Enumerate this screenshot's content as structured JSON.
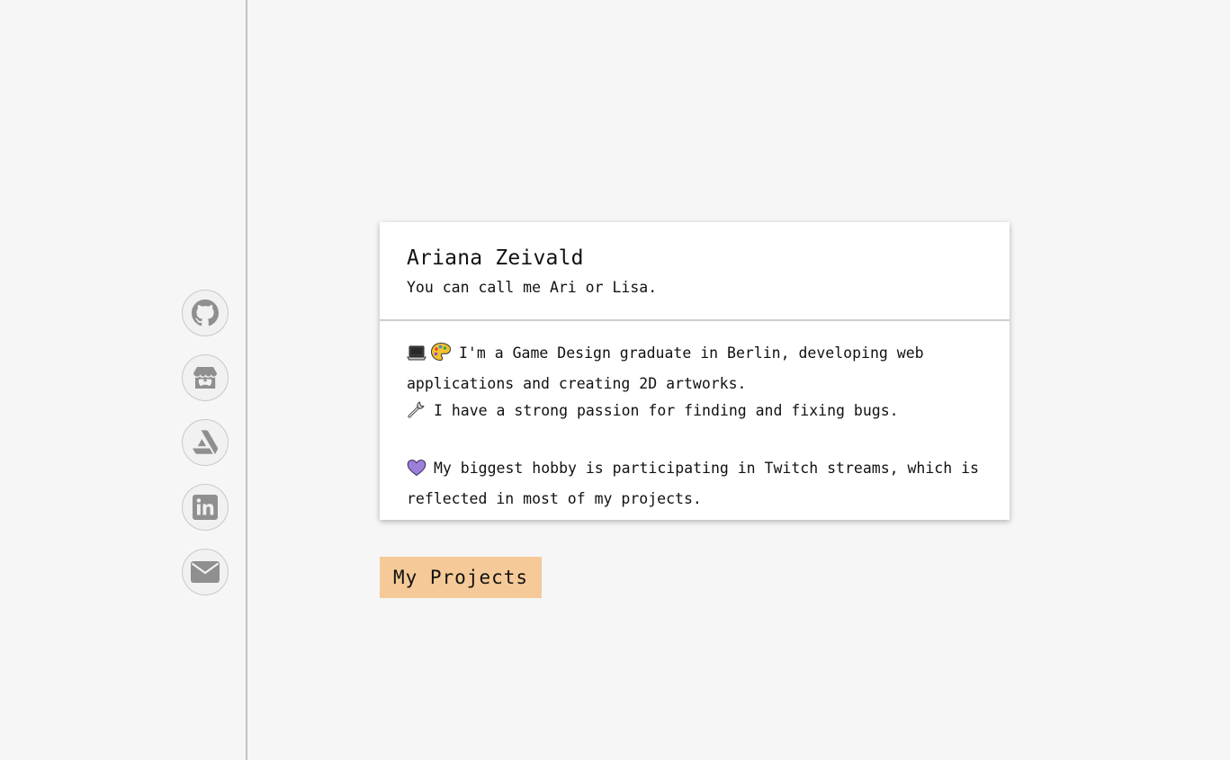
{
  "profile": {
    "name": "Ariana Zeivald",
    "tagline": "You can call me Ari or Lisa."
  },
  "about": {
    "line1_text": "I'm a Game Design graduate in Berlin, developing web applications and creating 2D artworks.",
    "line2_text": "I have a strong passion for finding and fixing bugs.",
    "line3_text": "My biggest hobby is participating in Twitch streams, which is reflected in most of my projects."
  },
  "social": [
    {
      "icon": "github-icon"
    },
    {
      "icon": "itch-io-icon"
    },
    {
      "icon": "artstation-icon"
    },
    {
      "icon": "linkedin-icon"
    },
    {
      "icon": "email-icon"
    }
  ],
  "projects_button": {
    "label": "My Projects"
  },
  "colors": {
    "background": "#f6f6f6",
    "card": "#ffffff",
    "button": "#f5ca98",
    "icon": "#8f8f8f",
    "heart": "#9b7fd9"
  }
}
